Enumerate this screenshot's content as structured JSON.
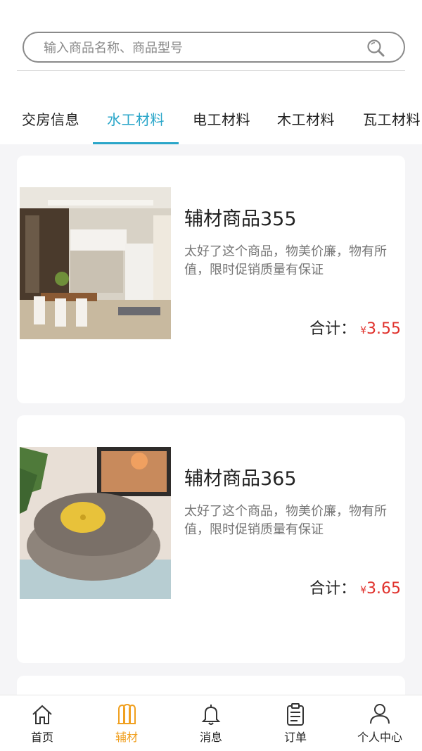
{
  "search": {
    "placeholder": "输入商品名称、商品型号"
  },
  "tabs": [
    {
      "label": "交房信息"
    },
    {
      "label": "水工材料"
    },
    {
      "label": "电工材料"
    },
    {
      "label": "木工材料"
    },
    {
      "label": "瓦工材料"
    }
  ],
  "active_tab": "水工材料",
  "products": [
    {
      "name": "辅材商品355",
      "desc": "太好了这个商品，物美价廉，物有所值，限时促销质量有保证",
      "total_label": "合计：",
      "currency": "¥",
      "price": "3.55"
    },
    {
      "name": "辅材商品365",
      "desc": "太好了这个商品，物美价廉，物有所值，限时促销质量有保证",
      "total_label": "合计：",
      "currency": "¥",
      "price": "3.65"
    }
  ],
  "nav": [
    {
      "label": "首页",
      "icon": "home-icon"
    },
    {
      "label": "辅材",
      "icon": "materials-icon"
    },
    {
      "label": "消息",
      "icon": "bell-icon"
    },
    {
      "label": "订单",
      "icon": "order-icon"
    },
    {
      "label": "个人中心",
      "icon": "user-icon"
    }
  ],
  "colors": {
    "accent": "#2aa6c9",
    "price": "#e0302b",
    "nav_active": "#f0a020"
  }
}
